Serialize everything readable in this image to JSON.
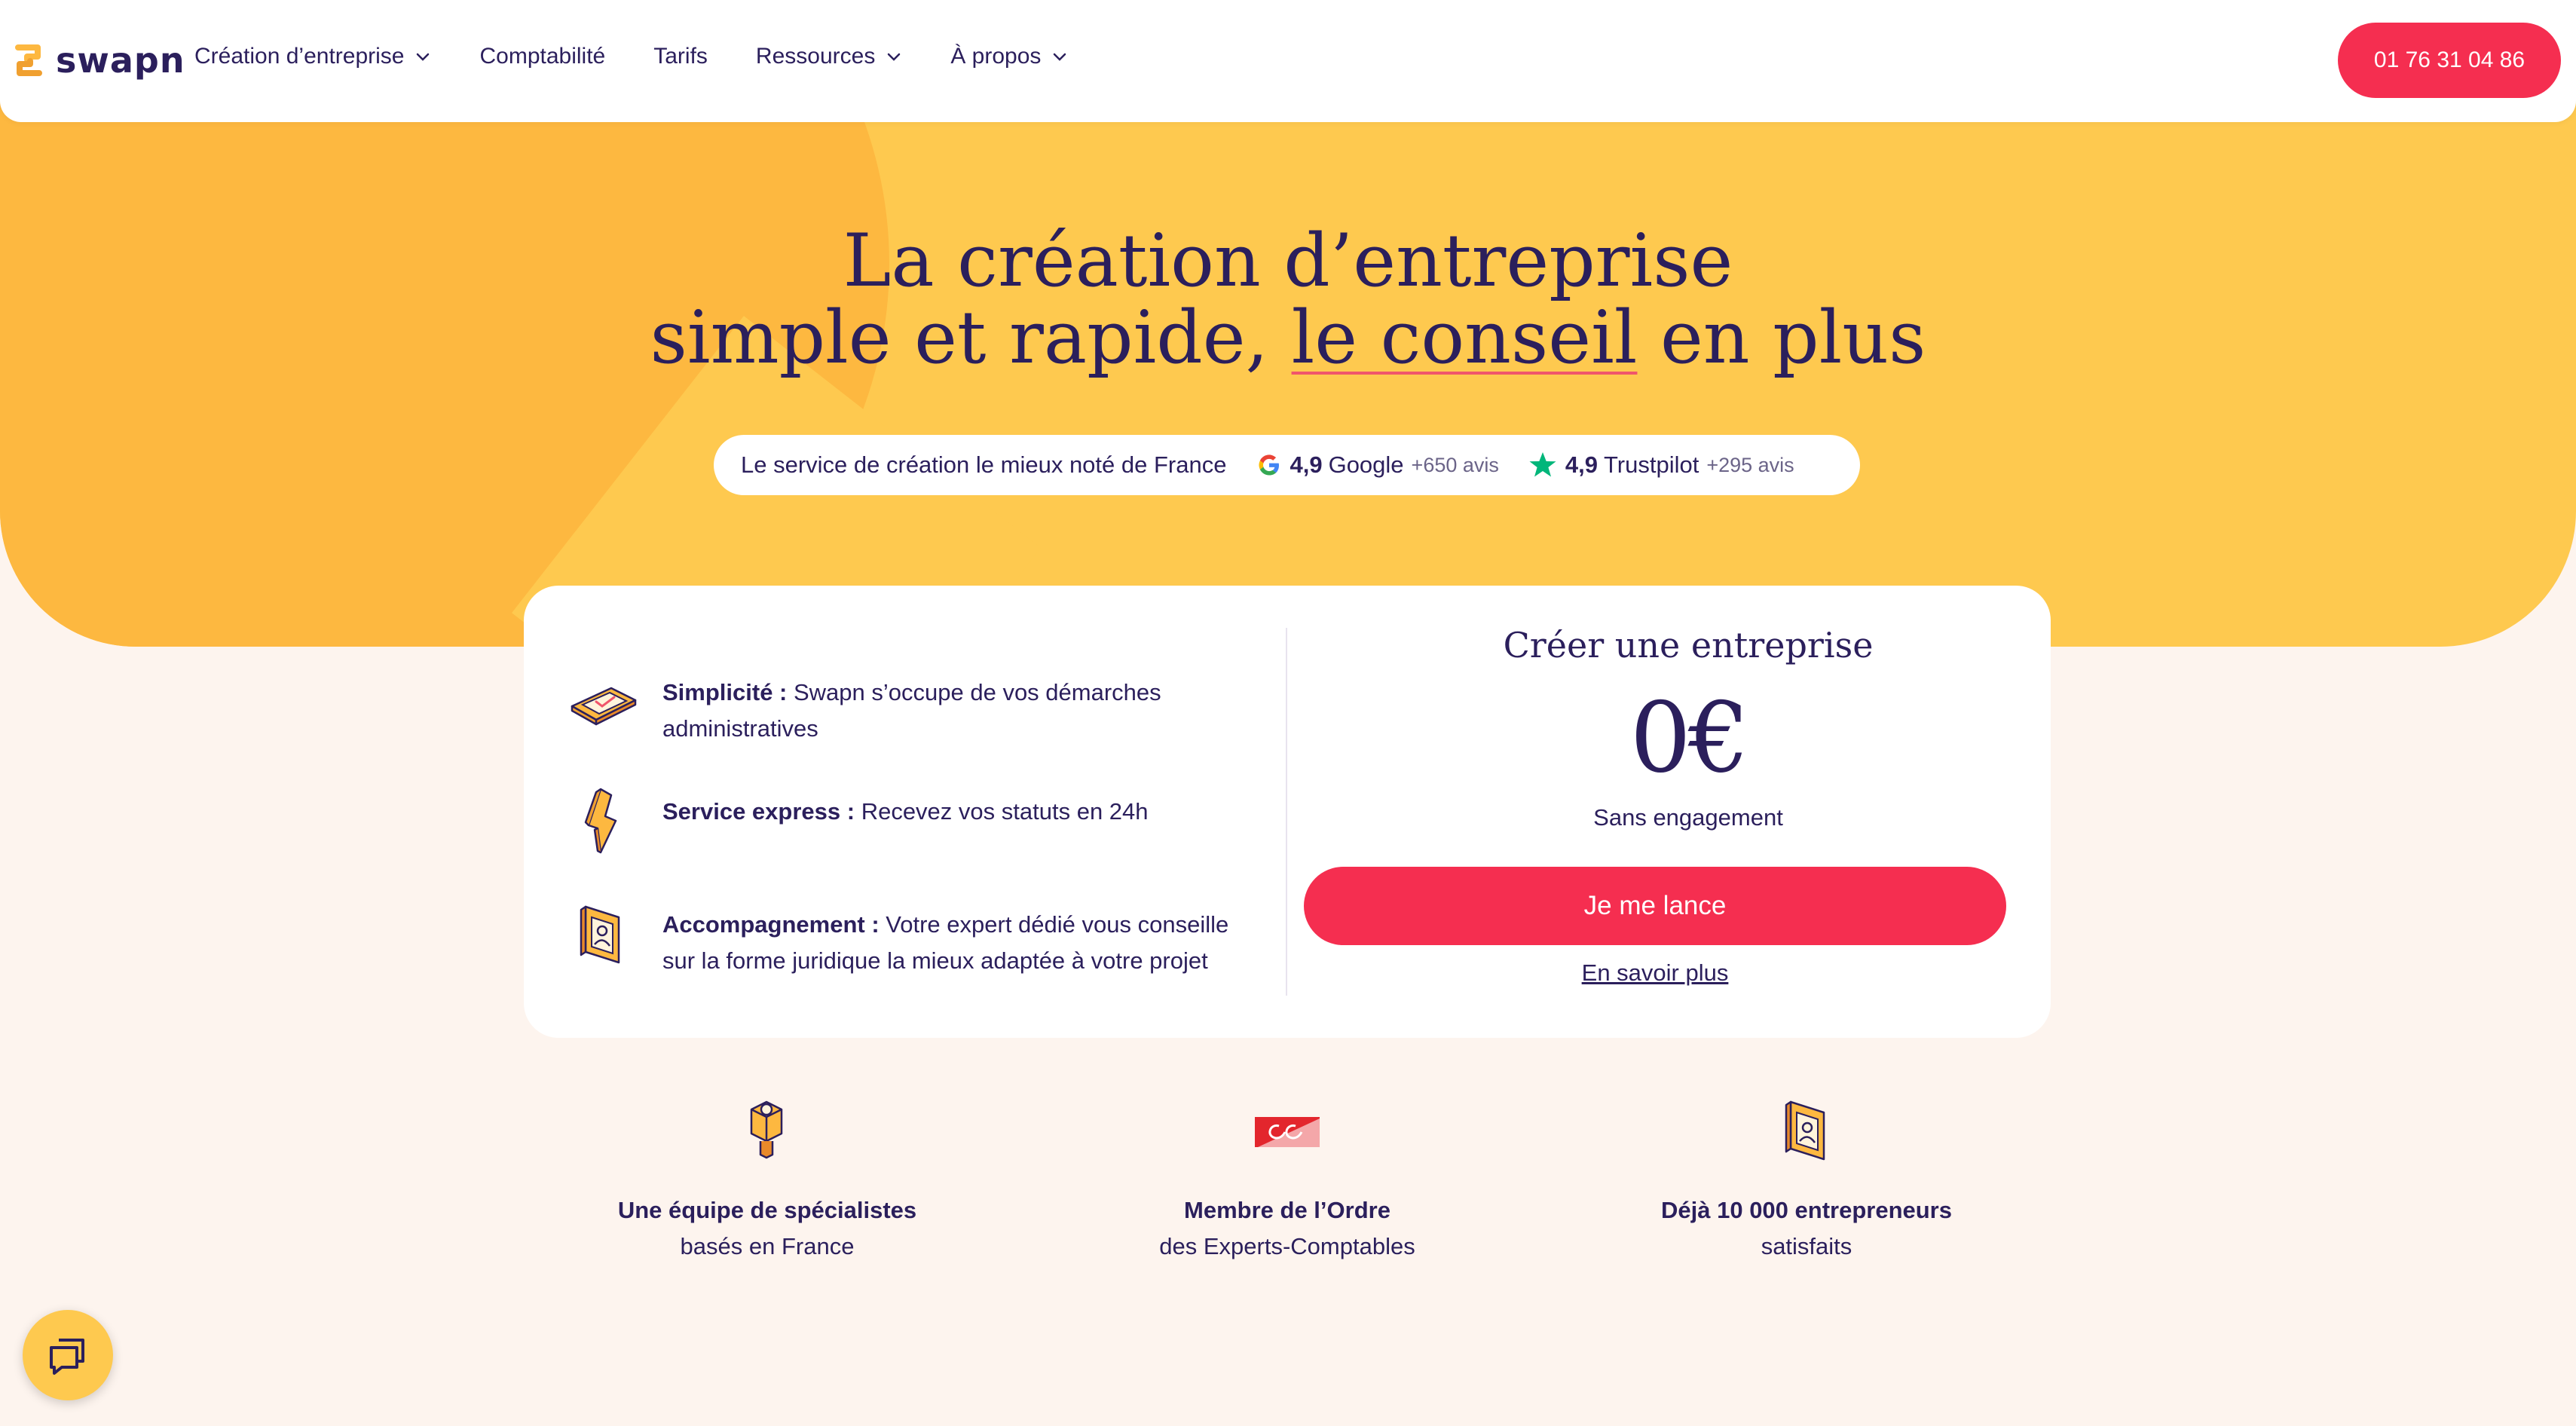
{
  "header": {
    "logo_text": "swapn",
    "nav": [
      {
        "label": "Création d’entreprise",
        "has_dropdown": true
      },
      {
        "label": "Comptabilité",
        "has_dropdown": false
      },
      {
        "label": "Tarifs",
        "has_dropdown": false
      },
      {
        "label": "Ressources",
        "has_dropdown": true
      },
      {
        "label": "À propos",
        "has_dropdown": true
      }
    ],
    "phone": "01 76 31 04 86"
  },
  "hero": {
    "line1": "La création d’entreprise",
    "line2_start": "simple et rapide, ",
    "line2_highlight": "le conseil",
    "line2_end": " en plus",
    "rating": {
      "intro": "Le service de création le mieux noté de France",
      "google_score": "4,9",
      "google_label": "Google",
      "google_count": "+650 avis",
      "trustpilot_score": "4,9",
      "trustpilot_label": "Trustpilot",
      "trustpilot_count": "+295 avis"
    }
  },
  "card": {
    "features": [
      {
        "icon": "document-icon",
        "title": "Simplicité :",
        "text": " Swapn s’occupe de vos démarches administratives"
      },
      {
        "icon": "lightning-icon",
        "title": "Service express :",
        "text": " Recevez vos statuts en 24h"
      },
      {
        "icon": "advisor-badge-icon",
        "title": "Accompagnement :",
        "text": " Votre expert dédié vous conseille sur la forme juridique la mieux adaptée à votre projet"
      }
    ],
    "price_title": "Créer une entreprise",
    "price": "0€",
    "price_note": "Sans engagement",
    "cta": "Je me lance",
    "learn_more": "En savoir plus"
  },
  "trust": [
    {
      "icon": "team-icon",
      "title": "Une équipe de spécialistes",
      "sub": "basés en France"
    },
    {
      "icon": "order-logo-icon",
      "title": "Membre de l’Ordre",
      "sub": "des Experts-Comptables"
    },
    {
      "icon": "entrepreneur-badge-icon",
      "title": "Déjà 10 000 entrepreneurs",
      "sub": "satisfaits"
    }
  ],
  "colors": {
    "accent": "#f52e50",
    "hero_bg": "#fec94f",
    "hero_shape": "#fdb840",
    "text": "#2b1f5c",
    "page_bg": "#fdf4ee"
  }
}
